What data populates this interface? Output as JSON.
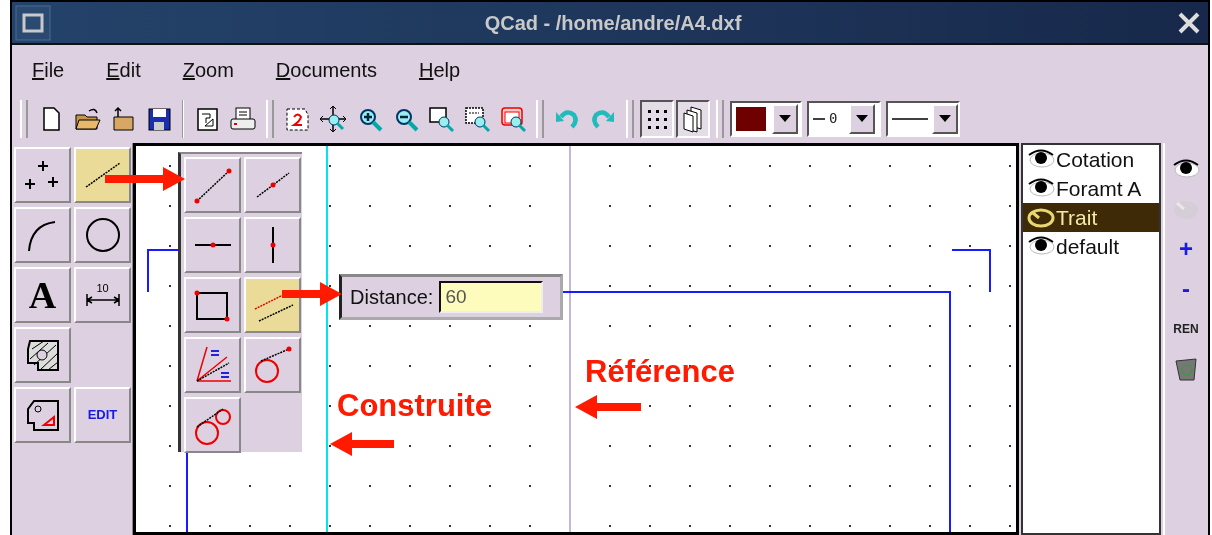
{
  "window": {
    "title": "QCad - /home/andre/A4.dxf"
  },
  "menu": [
    {
      "accel": "F",
      "rest": "ile"
    },
    {
      "accel": "E",
      "rest": "dit"
    },
    {
      "accel": "Z",
      "rest": "oom"
    },
    {
      "accel": "D",
      "rest": "ocuments"
    },
    {
      "accel": "H",
      "rest": "elp"
    }
  ],
  "toolbar": {
    "toggles": [
      {
        "kind": "grid",
        "pressed": true
      },
      {
        "kind": "pages",
        "pressed": true
      }
    ],
    "color_combo": {
      "color": "#6e0000"
    },
    "width_combo": {
      "value": "0"
    }
  },
  "tools": [
    {
      "kind": "points",
      "selected": false
    },
    {
      "kind": "line",
      "selected": true
    },
    {
      "kind": "arc",
      "selected": false
    },
    {
      "kind": "circle",
      "selected": false
    },
    {
      "kind": "text",
      "label": "A",
      "selected": false
    },
    {
      "kind": "dimension",
      "label": "10",
      "selected": false
    },
    {
      "kind": "hatch",
      "selected": false
    },
    {
      "kind": "blank"
    },
    {
      "kind": "block",
      "selected": false
    },
    {
      "kind": "edit",
      "label": "EDIT",
      "selected": false
    }
  ],
  "line_tools": [
    {
      "kind": "two-points",
      "selected": false
    },
    {
      "kind": "middle",
      "selected": false
    },
    {
      "kind": "horizontal",
      "selected": false
    },
    {
      "kind": "vertical",
      "selected": false
    },
    {
      "kind": "rectangle",
      "selected": false
    },
    {
      "kind": "parallel",
      "selected": true
    },
    {
      "kind": "bisector",
      "selected": false
    },
    {
      "kind": "tangent-point",
      "selected": false
    },
    {
      "kind": "tangent-circles",
      "selected": false
    }
  ],
  "distance": {
    "label": "Distance:",
    "value": "60"
  },
  "annotations": [
    {
      "text": "Référence"
    },
    {
      "text": "Construite"
    }
  ],
  "layers": [
    {
      "name": "Cotation",
      "selected": false
    },
    {
      "name": "Foramt A",
      "selected": false
    },
    {
      "name": "Trait",
      "selected": true
    },
    {
      "name": "default",
      "selected": false
    }
  ],
  "layer_buttons": [
    {
      "kind": "show",
      "disabled": false
    },
    {
      "kind": "hide",
      "disabled": true
    },
    {
      "kind": "add",
      "label": "+",
      "disabled": false
    },
    {
      "kind": "remove",
      "label": "-",
      "disabled": false
    },
    {
      "kind": "rename",
      "label": "REN",
      "disabled": false
    },
    {
      "kind": "delete",
      "disabled": false
    }
  ]
}
